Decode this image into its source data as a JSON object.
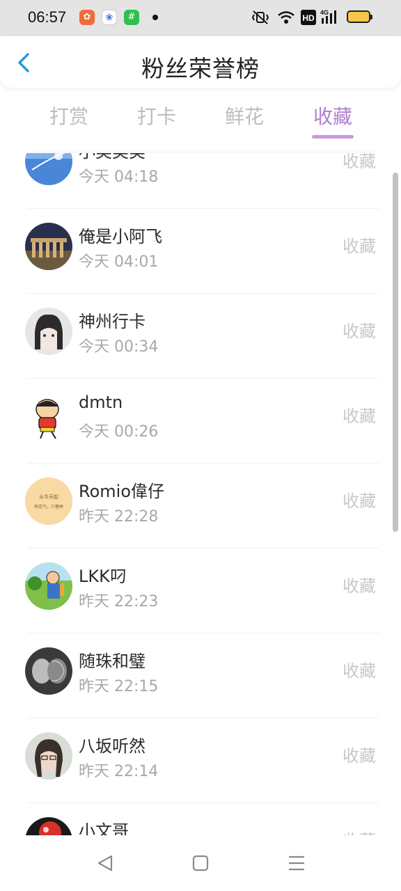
{
  "status_bar": {
    "time": "06:57",
    "right_icons": [
      "mute-vibrate-icon",
      "wifi-icon",
      "hd-icon",
      "4g-signal-icon",
      "battery-icon"
    ]
  },
  "header": {
    "title": "粉丝荣誉榜",
    "back_icon": "chevron-left-icon"
  },
  "tabs": [
    {
      "label": "打赏",
      "active": false
    },
    {
      "label": "打卡",
      "active": false
    },
    {
      "label": "鲜花",
      "active": false
    },
    {
      "label": "收藏",
      "active": true
    }
  ],
  "accent_color": "#b07fd0",
  "list": {
    "items": [
      {
        "name": "小美美美",
        "time": "今天 04:18",
        "action": "收藏"
      },
      {
        "name": "俺是小阿飞",
        "time": "今天 04:01",
        "action": "收藏"
      },
      {
        "name": "神州行卡",
        "time": "今天 00:34",
        "action": "收藏"
      },
      {
        "name": "dmtn",
        "time": "今天 00:26",
        "action": "收藏"
      },
      {
        "name": "Romio偉仔",
        "time": "昨天 22:28",
        "action": "收藏"
      },
      {
        "name": "LKK叼",
        "time": "昨天 22:23",
        "action": "收藏"
      },
      {
        "name": "随珠和璧",
        "time": "昨天 22:15",
        "action": "收藏"
      },
      {
        "name": "八坂听然",
        "time": "昨天 22:14",
        "action": "收藏"
      },
      {
        "name": "小文哥",
        "time": "",
        "action": "收藏"
      }
    ]
  },
  "avatar_texts": {
    "romio_line1": "从今天起",
    "romio_line2": "有志气，少蓉举"
  },
  "nav_bar": [
    "back-triangle-icon",
    "home-square-icon",
    "menu-lines-icon"
  ]
}
